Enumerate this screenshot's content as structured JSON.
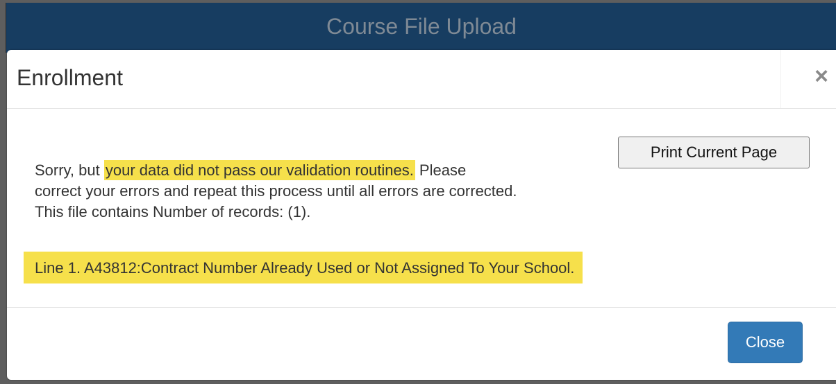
{
  "page": {
    "header_title": "Course File Upload"
  },
  "modal": {
    "title": "Enrollment",
    "close_glyph": "×",
    "print_label": "Print Current Page",
    "message": {
      "prefix": "Sorry, but ",
      "highlight": "your data did not pass our validation routines.",
      "suffix": " Please",
      "line2": "correct your errors and repeat this process until all errors are corrected.",
      "line3": "This file contains Number of records: (1)."
    },
    "error_line": "Line 1. A43812:Contract Number Already Used or Not Assigned To Your School.",
    "close_label": "Close"
  },
  "colors": {
    "header_bg": "#173d61",
    "highlight": "#f6e04b",
    "primary_button": "#337ab7"
  }
}
